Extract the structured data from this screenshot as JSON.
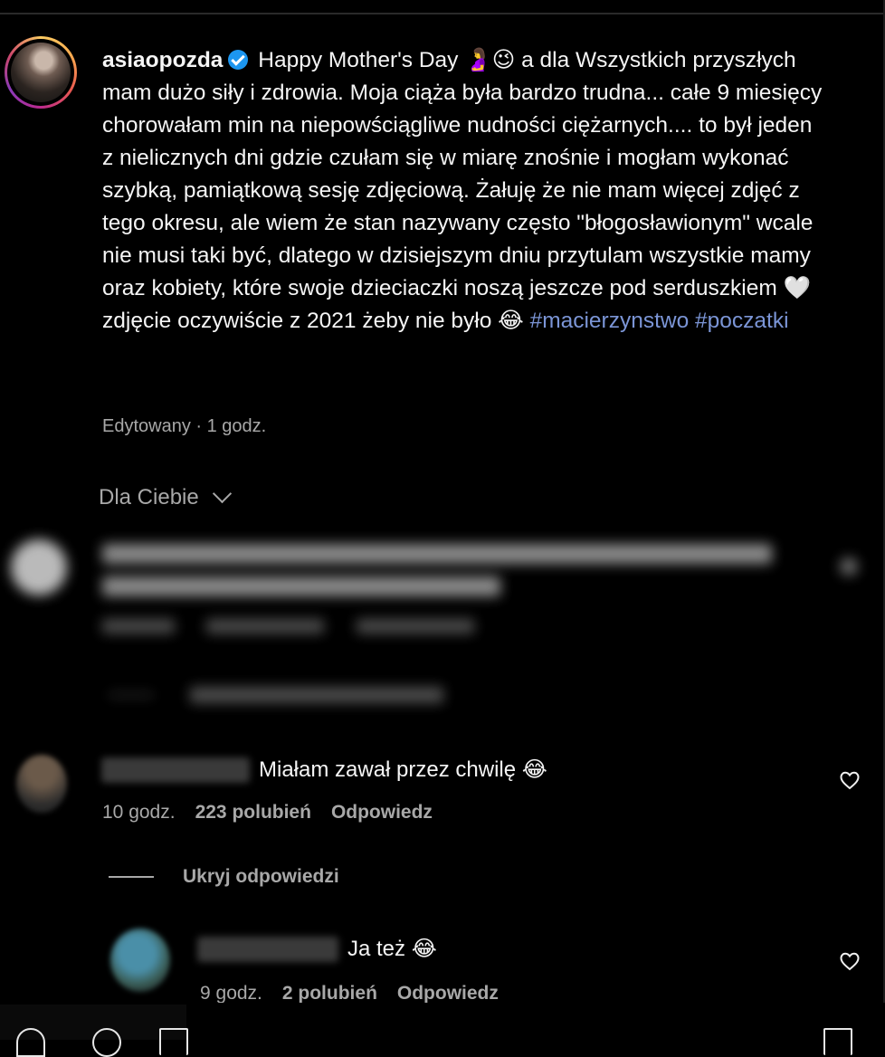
{
  "post": {
    "username": "asiaopozda",
    "caption_text": "Happy Mother's Day 🤰😉 a dla Wszystkich przyszłych mam dużo siły i zdrowia. Moja ciąża była bardzo trudna... całe 9 miesięcy chorowałam min na niepowściągliwe nudności ciężarnych.... to był jeden z nielicznych dni gdzie czułam się w miarę znośnie i mogłam wykonać szybką, pamiątkową sesję zdjęciową. Żałuję że nie mam więcej zdjęć z tego okresu, ale wiem że stan nazywany często \"błogosławionym\" wcale nie musi taki być, dlatego w dzisiejszym dniu przytulam wszystkie mamy oraz kobiety, które swoje dzieciaczki noszą jeszcze pod serduszkiem 🤍 zdjęcie oczywiście z 2021 żeby nie było 😂",
    "hashtags": [
      "#macierzynstwo",
      "#poczatki"
    ],
    "meta": "Edytowany · 1 godz."
  },
  "sort": {
    "label": "Dla Ciebie"
  },
  "comments": [
    {
      "text": "Miałam zawał przez chwilę 😂",
      "time": "10 godz.",
      "likes": "223 polubień",
      "reply_label": "Odpowiedz",
      "hide_replies": "Ukryj odpowiedzi",
      "replies": [
        {
          "text": "Ja też 😂",
          "time": "9 godz.",
          "likes": "2 polubień",
          "reply_label": "Odpowiedz"
        }
      ]
    }
  ],
  "icons": [
    "verified-badge-icon",
    "chevron-down-icon",
    "heart-icon"
  ],
  "colors": {
    "background": "#000000",
    "text": "#f5f5f5",
    "muted": "#a8a8a8",
    "hashtag": "#7b95d6",
    "verified": "#1c96f0"
  }
}
